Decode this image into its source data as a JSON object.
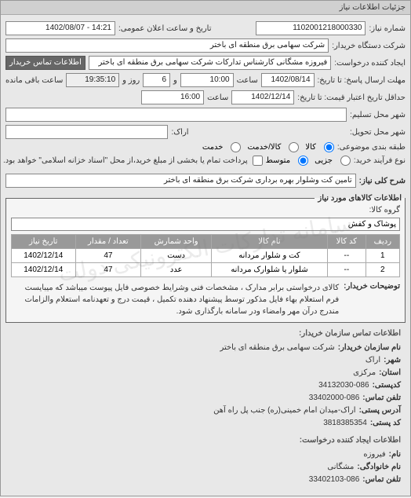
{
  "panel_title": "جزئیات اطلاعات نیاز",
  "top": {
    "number_label": "شماره نیاز:",
    "number_value": "1102001218000330",
    "public_date_label": "تاریخ و ساعت اعلان عمومی:",
    "public_date_value": "14:21 - 1402/08/07",
    "buyer_label": "شرکت دستگاه خریدار:",
    "buyer_value": "شرکت سهامی برق منطقه ای باختر",
    "requester_label": "ایجاد کننده درخواست:",
    "requester_value": "فیروزه مشگانی کارشناس تدارکات شرکت سهامی برق منطقه ای باختر",
    "buyer_contact_btn": "اطلاعات تماس خریدار",
    "deadline_reply_label": "مهلت ارسال پاسخ: تا تاریخ:",
    "deadline_reply_date": "1402/08/14",
    "deadline_reply_time_lbl": "ساعت",
    "deadline_reply_time": "10:00",
    "remaining_days_lbl": "و",
    "remaining_days": "6",
    "remaining_days_suffix": "روز و",
    "remaining_time": "19:35:10",
    "remaining_suffix": "ساعت باقی مانده",
    "validity_label": "حداقل تاریخ اعتبار قیمت: تا تاریخ:",
    "validity_date": "1402/12/14",
    "validity_time_lbl": "ساعت",
    "validity_time": "16:00",
    "city_trans_label": "شهر محل تسلیم:",
    "city_deliv_label": "شهر محل تحویل:",
    "city_arak": "اراک:",
    "package_q_label": "طبقه بندی موضوعی:",
    "pkg_kala": "کالا",
    "pkg_khadamat": "کالا/خدمت",
    "pkg_khad": "خدمت",
    "buy_process_label": "نوع فرآیند خرید:",
    "proc_small": "جزیی",
    "proc_med": "متوسط",
    "proc_note": "پرداخت تمام یا بخشی از مبلغ خرید،از محل \"اسناد خزانه اسلامی\" خواهد بود.",
    "summary_label": "شرح کلی نیاز:",
    "summary_value": "تامین کت وشلوار بهره برداری شرکت برق منطقه ای باختر"
  },
  "goods": {
    "section_title": "اطلاعات کالاهای مورد نیاز",
    "group_label": "گروه کالا:",
    "group_value": "پوشاک و کفش",
    "cols": [
      "ردیف",
      "کد کالا",
      "نام کالا",
      "واحد شمارش",
      "تعداد / مقدار",
      "تاریخ نیاز"
    ],
    "rows": [
      {
        "n": "1",
        "code": "--",
        "name": "کت و شلوار مردانه",
        "unit": "دست",
        "qty": "47",
        "date": "1402/12/14"
      },
      {
        "n": "2",
        "code": "--",
        "name": "شلوار یا شلوارک مردانه",
        "unit": "عدد",
        "qty": "47",
        "date": "1402/12/14"
      }
    ],
    "desc_label": "توضیحات خریدار:",
    "desc_text": "کالای درخواستی برابر مدارک ، مشخصات فنی وشرایط خصوصی فایل پیوست میباشد که میبایست فرم استعلام بهاء فایل مذکور توسط پیشنهاد دهنده تکمیل ، قیمت درج و تعهدنامه استعلام والزامات مندرج درآن مهر وامضاء ودر سامانه بارگذاری شود."
  },
  "contact": {
    "section_title": "اطلاعات تماس سازمان خریدار:",
    "org_label": "نام سازمان خریدار:",
    "org_value": "شرکت سهامی برق منطقه ای باختر",
    "city_label": "شهر:",
    "city_value": "اراک",
    "center_label": "استان:",
    "center_value": "مرکزی",
    "post_label": "کدپستی:",
    "post_value": "34132030-086",
    "phone_label": "تلفن تماس:",
    "phone_value": "33402000-086",
    "addr_label": "آدرس پستی:",
    "addr_value": "اراک-میدان امام خمینی(ره) جنب پل راه آهن",
    "postal_code_label": "کد پستی:",
    "postal_code_value": "3818385354",
    "requester_section": "اطلاعات ایجاد کننده درخواست:",
    "fname_label": "نام:",
    "fname_value": "فیروزه",
    "lname_label": "نام خانوادگی:",
    "lname_value": "مشگانی",
    "rphone_label": "تلفن تماس:",
    "rphone_value": "33402103-086"
  },
  "watermark": "سامانه تدارکات الکترونیکی دولت"
}
